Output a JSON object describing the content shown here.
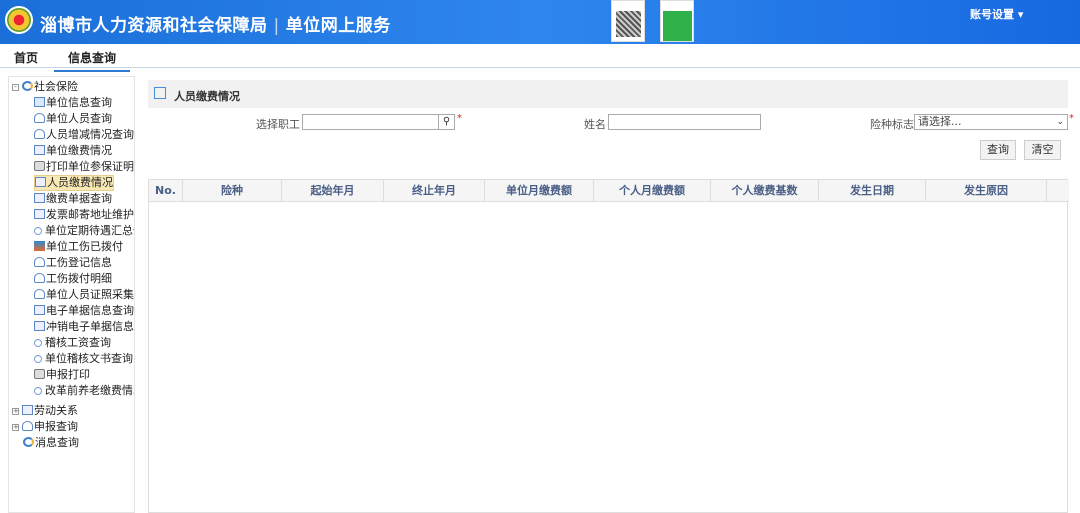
{
  "header": {
    "org": "淄博市人力资源和社会保障局",
    "separator": "|",
    "service": "单位网上服务",
    "account": "账号设置 ▾"
  },
  "nav": {
    "tabs": [
      "首页",
      "信息查询"
    ],
    "active": "信息查询"
  },
  "sidebar": {
    "root": "社会保险",
    "items": [
      {
        "label": "单位信息查询",
        "icon": "grid"
      },
      {
        "label": "单位人员查询",
        "icon": "user"
      },
      {
        "label": "人员增减情况查询",
        "icon": "user"
      },
      {
        "label": "单位缴费情况",
        "icon": "card"
      },
      {
        "label": "打印单位参保证明",
        "icon": "print"
      },
      {
        "label": "人员缴费情况",
        "icon": "card",
        "selected": true
      },
      {
        "label": "缴费单据查询",
        "icon": "card"
      },
      {
        "label": "发票邮寄地址维护",
        "icon": "card"
      },
      {
        "label": "单位定期待遇汇总信",
        "icon": "search"
      },
      {
        "label": "单位工伤已拨付",
        "icon": "tool"
      },
      {
        "label": "工伤登记信息",
        "icon": "user"
      },
      {
        "label": "工伤拨付明细",
        "icon": "user"
      },
      {
        "label": "单位人员证照采集",
        "icon": "user"
      },
      {
        "label": "电子单据信息查询",
        "icon": "card"
      },
      {
        "label": "冲销电子单据信息查",
        "icon": "card"
      },
      {
        "label": "稽核工资查询",
        "icon": "search"
      },
      {
        "label": "单位稽核文书查询",
        "icon": "search"
      },
      {
        "label": "申报打印",
        "icon": "print"
      },
      {
        "label": "改革前养老缴费情况",
        "icon": "search"
      }
    ],
    "others": [
      "劳动关系",
      "申报查询",
      "消息查询"
    ]
  },
  "panel": {
    "title": "人员缴费情况",
    "form": {
      "employee_label": "选择职工",
      "employee_value": "",
      "name_label": "姓名",
      "name_value": "",
      "insurance_label": "险种标志",
      "insurance_selected": "请选择...",
      "required": "*"
    },
    "buttons": {
      "query": "查询",
      "clear": "清空"
    },
    "table": {
      "columns": [
        "No.",
        "险种",
        "起始年月",
        "终止年月",
        "单位月缴费额",
        "个人月缴费额",
        "个人缴费基数",
        "发生日期",
        "发生原因"
      ],
      "rows": []
    }
  }
}
